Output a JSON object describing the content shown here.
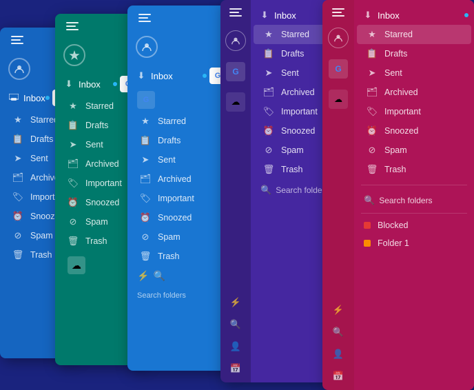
{
  "panels": [
    {
      "id": "panel1",
      "color": "#1565c0",
      "items": [
        "Inbox",
        "Starred",
        "Drafts",
        "Sent",
        "Archived",
        "Important",
        "Snoozed",
        "Spam",
        "Trash"
      ]
    },
    {
      "id": "panel2",
      "color": "#00796b",
      "items": [
        "Inbox",
        "Starred",
        "Drafts",
        "Sent",
        "Archived",
        "Important",
        "Snoozed",
        "Spam",
        "Trash"
      ]
    },
    {
      "id": "panel3",
      "color": "#1976d2",
      "items": [
        "Inbox",
        "Starred",
        "Drafts",
        "Sent",
        "Archived",
        "Important",
        "Snoozed",
        "Spam",
        "Trash"
      ]
    },
    {
      "id": "panel4",
      "color": "#4527a0",
      "items": [
        "Inbox",
        "Starred",
        "Drafts",
        "Sent",
        "Archived",
        "Important",
        "Snoozed",
        "Spam",
        "Trash"
      ]
    },
    {
      "id": "panel5",
      "color": "#c2185b",
      "items": [
        "Inbox",
        "Starred",
        "Drafts",
        "Sent",
        "Archived",
        "Important",
        "Snoozed",
        "Spam",
        "Trash"
      ]
    }
  ],
  "nav": {
    "inbox": "Inbox",
    "starred": "Starred",
    "drafts": "Drafts",
    "sent": "Sent",
    "archived": "Archived",
    "important": "Important",
    "snoozed": "Snoozed",
    "spam": "Spam",
    "trash": "Trash",
    "search_folders": "Search folders",
    "blocked": "Blocked",
    "folder1": "Folder 1"
  },
  "icons": {
    "hamburger": "☰",
    "inbox": "⬇",
    "star": "★",
    "draft": "📋",
    "send": "➤",
    "archive": "🗂",
    "important": "🏷",
    "snooze": "⏰",
    "spam": "⊘",
    "trash": "🗑",
    "search": "🔍",
    "pulse": "⚡",
    "person": "👤",
    "calendar": "📅",
    "color_red": "#e53935",
    "color_orange": "#fb8c00"
  }
}
